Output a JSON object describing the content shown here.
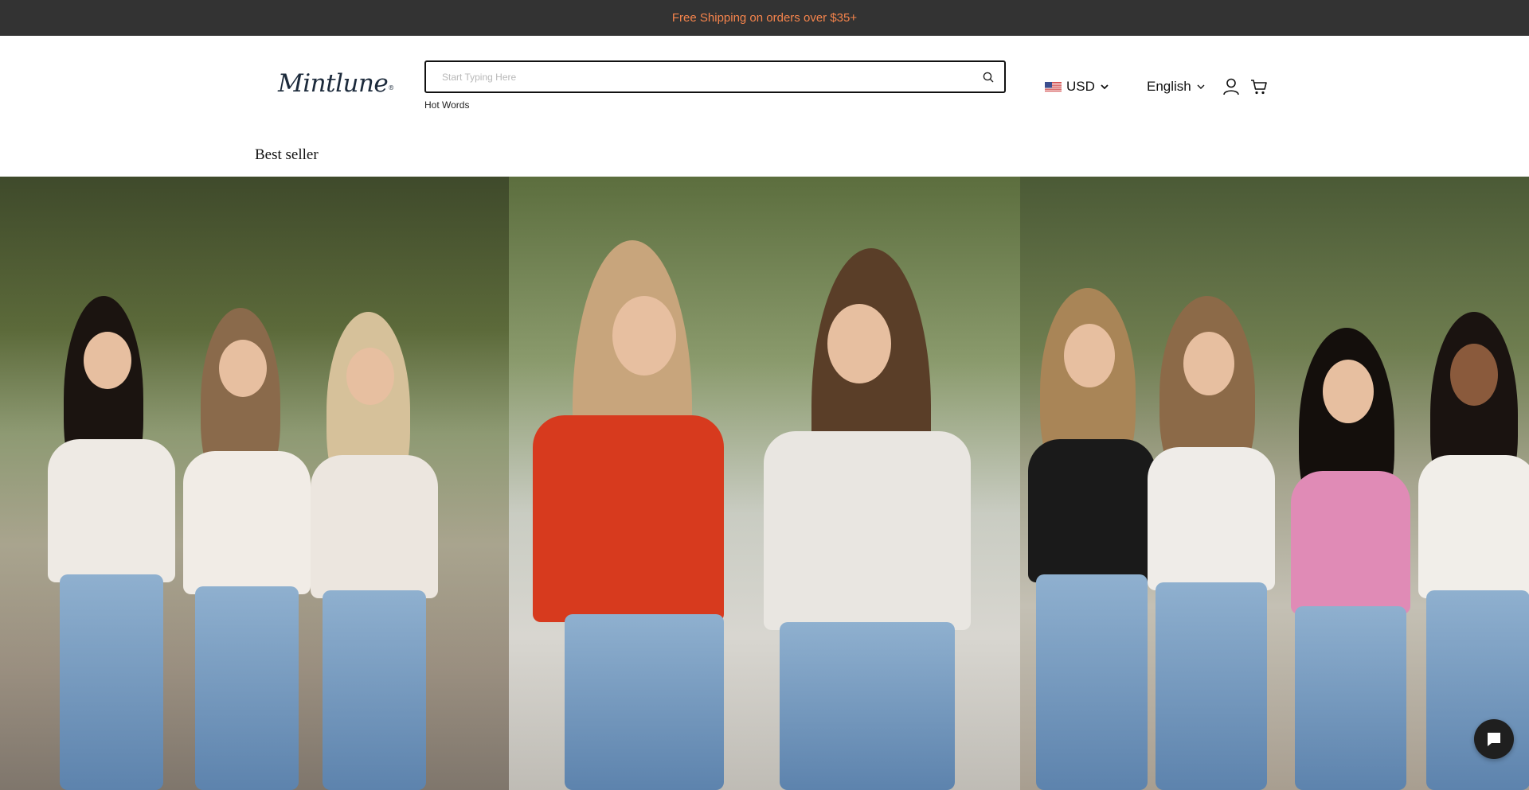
{
  "announcement": {
    "text": "Free Shipping on orders over $35+"
  },
  "header": {
    "logo_text": "Mintlune",
    "search": {
      "placeholder": "Start Typing Here",
      "value": ""
    },
    "hot_words_label": "Hot Words",
    "currency": {
      "code": "USD",
      "flag_icon": "us-flag-icon"
    },
    "language": {
      "label": "English"
    },
    "icons": [
      "search-icon",
      "user-account-icon",
      "shopping-cart-icon",
      "chevron-down-icon"
    ]
  },
  "nav": {
    "items": [
      {
        "label": "Best seller"
      }
    ]
  },
  "hero": {
    "panels": [
      "hero-photo-left",
      "hero-photo-center",
      "hero-photo-right"
    ]
  },
  "chat": {
    "icon": "chat-bubble-icon"
  },
  "colors": {
    "announcement_bg": "#333333",
    "announcement_text": "#f5844c",
    "text": "#111111",
    "chat_button": "#1f1f1f"
  }
}
